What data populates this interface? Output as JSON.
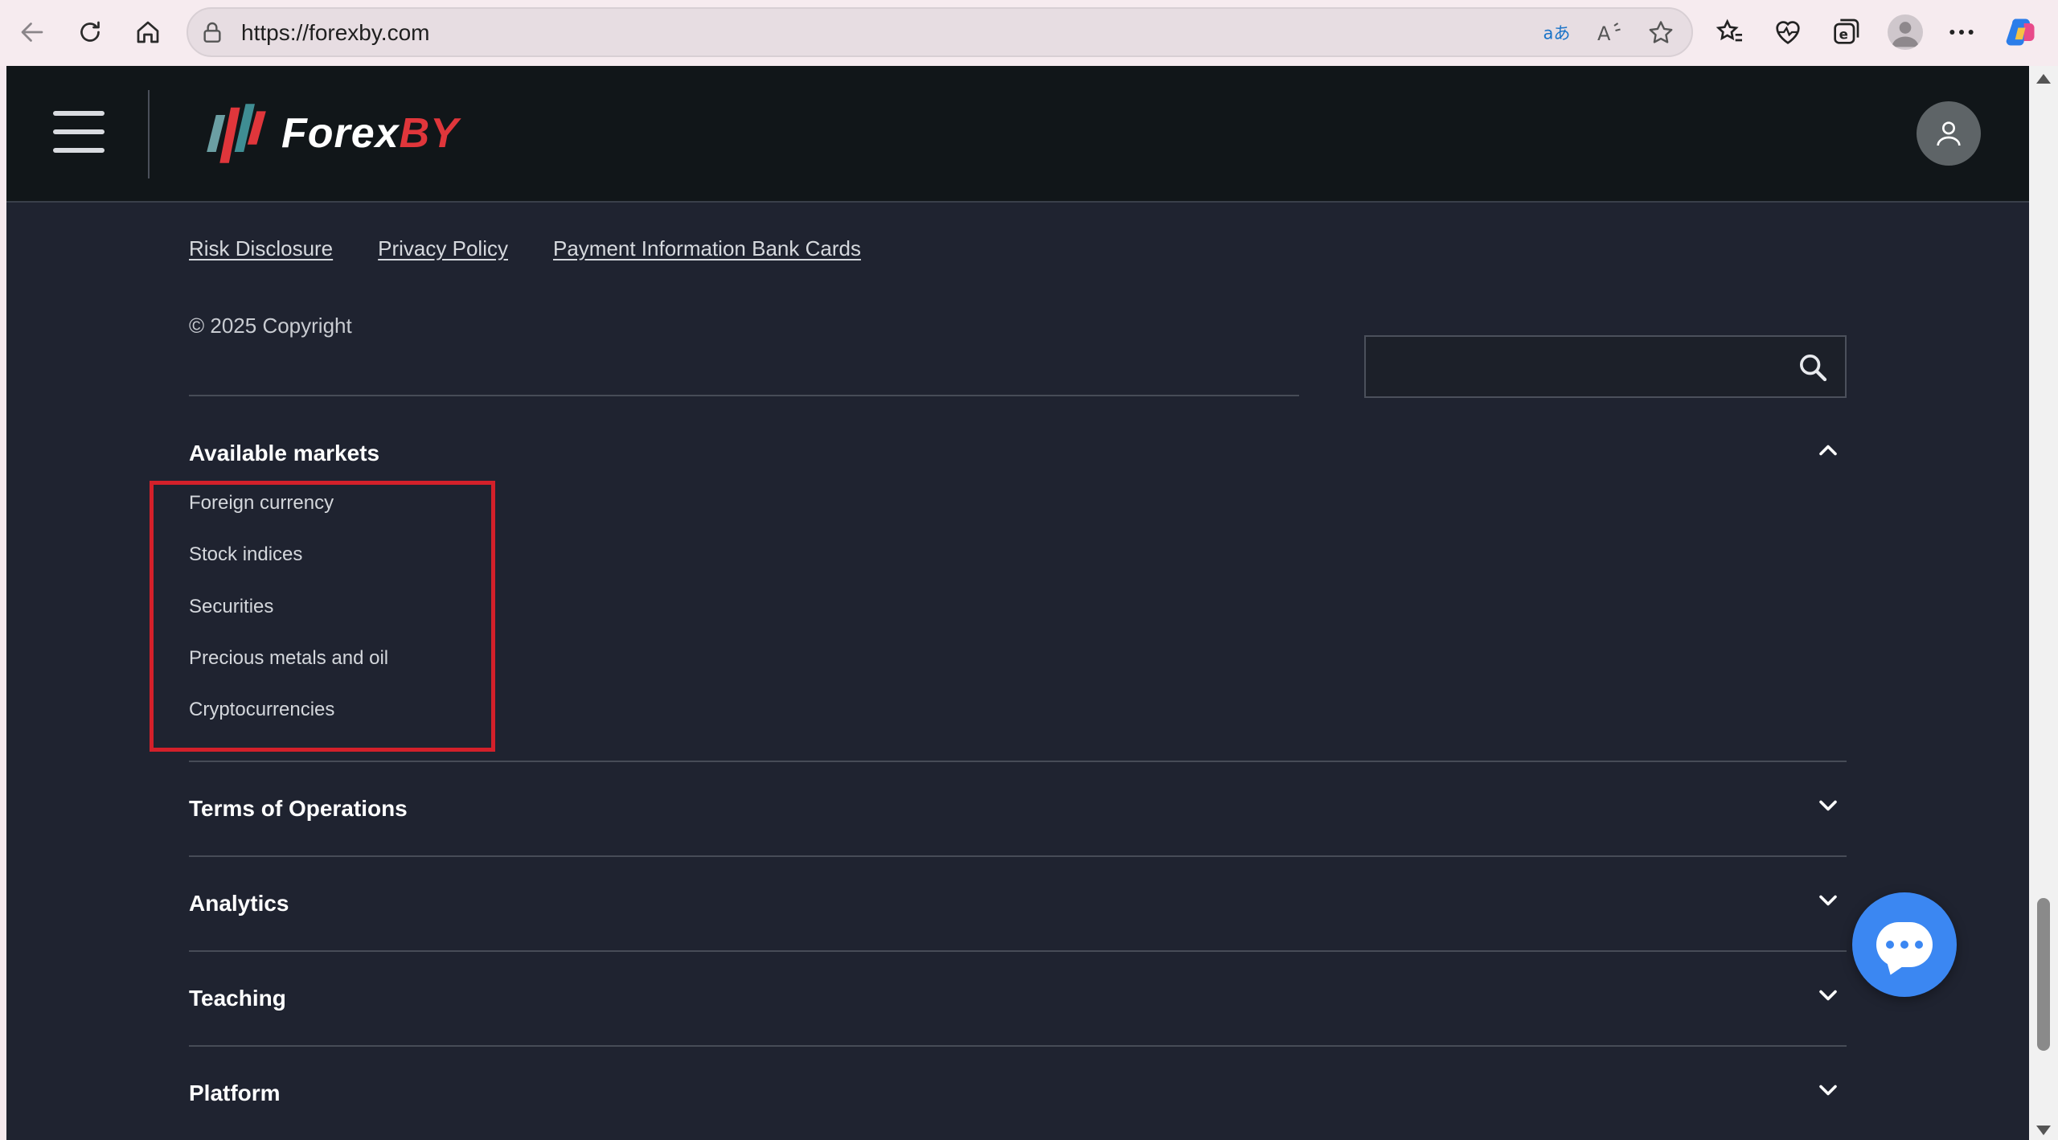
{
  "browser": {
    "url": "https://forexby.com"
  },
  "header": {
    "logo_text": "Forex",
    "logo_text_accent": "BY"
  },
  "footer": {
    "links": [
      "Risk Disclosure",
      "Privacy Policy",
      "Payment Information Bank Cards"
    ],
    "copyright": "© 2025 Copyright",
    "search_placeholder": ""
  },
  "accordion": {
    "available_markets": {
      "title": "Available markets",
      "items": [
        "Foreign currency",
        "Stock indices",
        "Securities",
        "Precious metals and oil",
        "Cryptocurrencies"
      ]
    },
    "sections": [
      "Terms of Operations",
      "Analytics",
      "Teaching",
      "Platform"
    ]
  },
  "colors": {
    "page_bg": "#1f2330",
    "header_bg": "#111619",
    "highlight": "#d3202a",
    "chat_button": "#3b87f2",
    "logo_accent": "#e0363b"
  }
}
